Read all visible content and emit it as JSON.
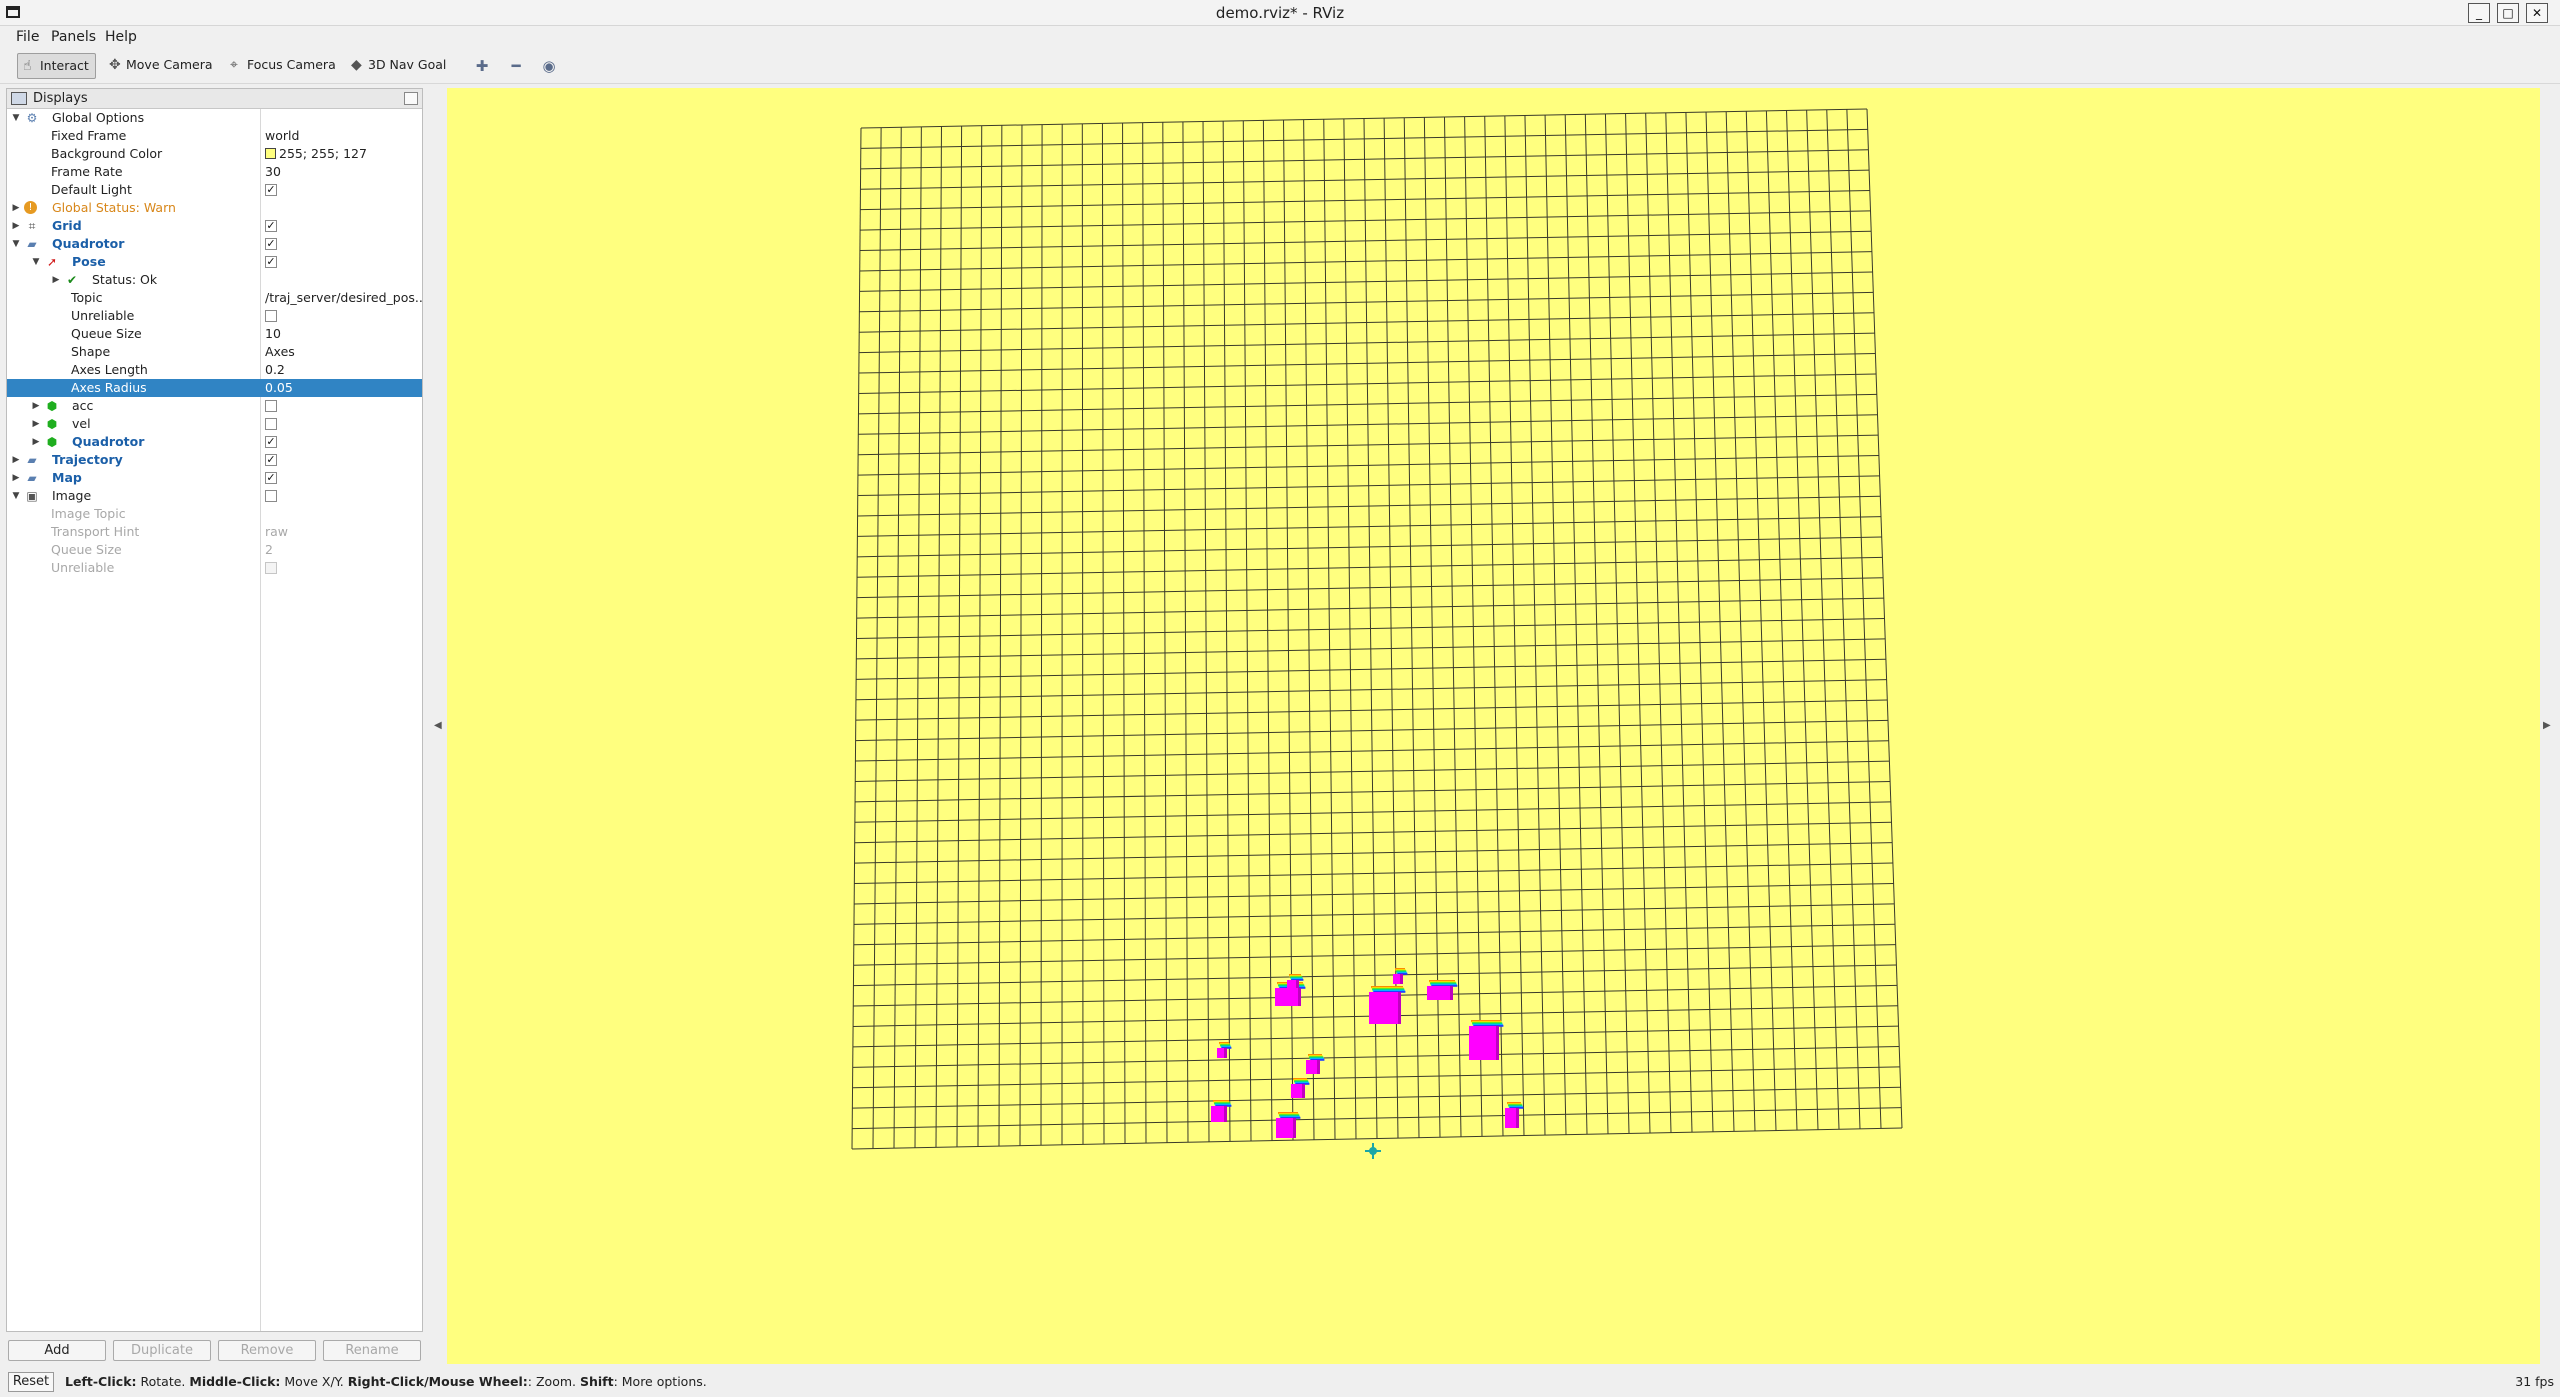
{
  "window": {
    "title": "demo.rviz* - RViz"
  },
  "menubar": {
    "file": "File",
    "panels": "Panels",
    "help": "Help"
  },
  "toolbar": {
    "interact": "Interact",
    "move_camera": "Move Camera",
    "focus_camera": "Focus Camera",
    "nav_goal": "3D Nav Goal"
  },
  "displays": {
    "title": "Displays",
    "global_options": "Global Options",
    "fixed_frame_label": "Fixed Frame",
    "fixed_frame_value": "world",
    "background_color_label": "Background Color",
    "background_color_value": "255; 255; 127",
    "background_color_hex": "#ffff7f",
    "frame_rate_label": "Frame Rate",
    "frame_rate_value": "30",
    "default_light_label": "Default Light",
    "global_status": "Global Status: Warn",
    "grid": "Grid",
    "quadrotor": "Quadrotor",
    "pose": "Pose",
    "status_ok": "Status: Ok",
    "topic_label": "Topic",
    "topic_value": "/traj_server/desired_pos...",
    "unreliable_label": "Unreliable",
    "queue_size_label": "Queue Size",
    "queue_size_value": "10",
    "shape_label": "Shape",
    "shape_value": "Axes",
    "axes_length_label": "Axes Length",
    "axes_length_value": "0.2",
    "axes_radius_label": "Axes Radius",
    "axes_radius_value": "0.05",
    "acc": "acc",
    "vel": "vel",
    "quadrotor_child": "Quadrotor",
    "trajectory": "Trajectory",
    "map": "Map",
    "image": "Image",
    "image_topic_label": "Image Topic",
    "transport_hint_label": "Transport Hint",
    "transport_hint_value": "raw",
    "image_queue_label": "Queue Size",
    "image_queue_value": "2",
    "image_unreliable_label": "Unreliable"
  },
  "buttons": {
    "add": "Add",
    "duplicate": "Duplicate",
    "remove": "Remove",
    "rename": "Rename"
  },
  "statusbar": {
    "reset": "Reset",
    "hint_left": "Left-Click:",
    "hint_left_text": " Rotate. ",
    "hint_middle": "Middle-Click:",
    "hint_middle_text": " Move X/Y. ",
    "hint_right": "Right-Click/Mouse Wheel:",
    "hint_right_text": ": Zoom. ",
    "hint_shift": "Shift",
    "hint_shift_text": ": More options.",
    "fps": "31 fps"
  },
  "colors": {
    "accent": "#3084c4",
    "warn": "#d8871a",
    "link": "#1b5fa8",
    "obstacle": "#ff00ff"
  }
}
